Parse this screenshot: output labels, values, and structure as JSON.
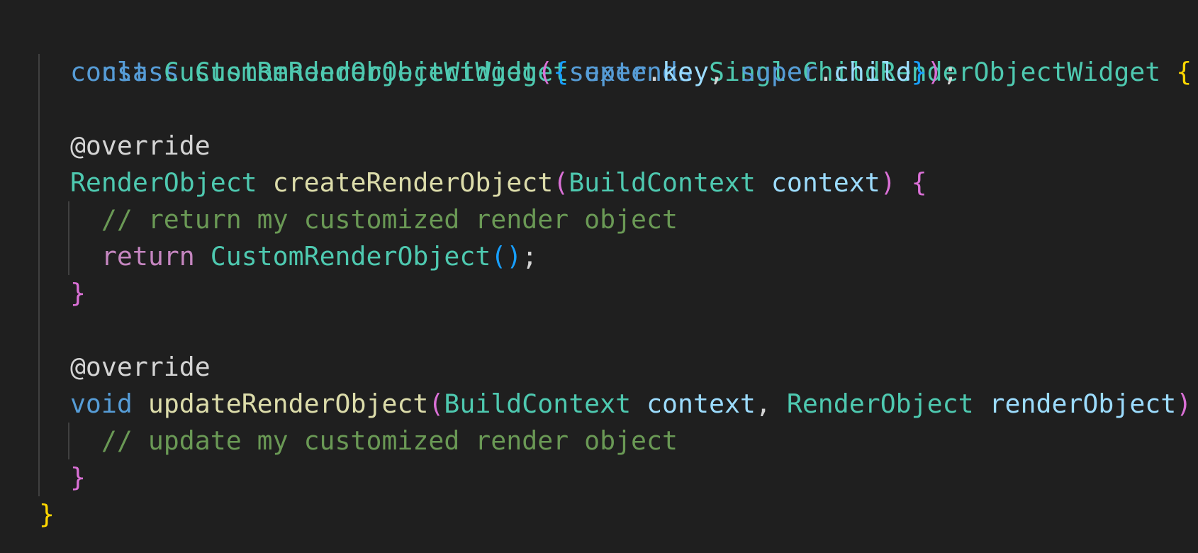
{
  "code": {
    "l1": {
      "indent": "",
      "kw_class": "class",
      "class_name": "CustomRenderObjectWidget",
      "kw_extends": "extends",
      "super_class": "SingleChildRenderObjectWidget",
      "brace_open": "{"
    },
    "l2": {
      "indent": "  ",
      "kw_const": "const",
      "ctor_name": "CustomRenderObjectWidget",
      "paren_open": "(",
      "brace_open": "{",
      "super1": "super",
      "dot1": ".",
      "field1": "key",
      "comma": ", ",
      "super2": "super",
      "dot2": ".",
      "field2": "child",
      "brace_close": "}",
      "paren_close": ")",
      "semi": ";"
    },
    "l4": {
      "indent": "  ",
      "annotation": "@override"
    },
    "l5": {
      "indent": "  ",
      "ret_type": "RenderObject",
      "method": "createRenderObject",
      "paren_open": "(",
      "param_type": "BuildContext",
      "param_name": "context",
      "paren_close": ")",
      "brace_open": "{"
    },
    "l6": {
      "indent": "    ",
      "comment": "// return my customized render object"
    },
    "l7": {
      "indent": "    ",
      "kw_return": "return",
      "ctor": "CustomRenderObject",
      "paren_open": "(",
      "paren_close": ")",
      "semi": ";"
    },
    "l8": {
      "indent": "  ",
      "brace_close": "}"
    },
    "l10": {
      "indent": "  ",
      "annotation": "@override"
    },
    "l11": {
      "indent": "  ",
      "kw_void": "void",
      "method": "updateRenderObject",
      "paren_open": "(",
      "param1_type": "BuildContext",
      "param1_name": "context",
      "comma": ", ",
      "param2_type": "RenderObject",
      "param2_name": "renderObject",
      "paren_close": ")",
      "brace_open": "{"
    },
    "l12": {
      "indent": "    ",
      "comment": "// update my customized render object"
    },
    "l13": {
      "indent": "  ",
      "brace_close": "}"
    },
    "l14": {
      "indent": "",
      "brace_close": "}"
    }
  },
  "colors": {
    "background": "#1f1f1f",
    "keyword": "#569cd6",
    "control": "#c586c0",
    "type": "#4ec9b0",
    "function": "#dcdcaa",
    "variable": "#9cdcfe",
    "comment": "#6a9955",
    "bracket_level1": "#ffd700",
    "bracket_level2": "#da70d6",
    "bracket_level3": "#179fff"
  }
}
